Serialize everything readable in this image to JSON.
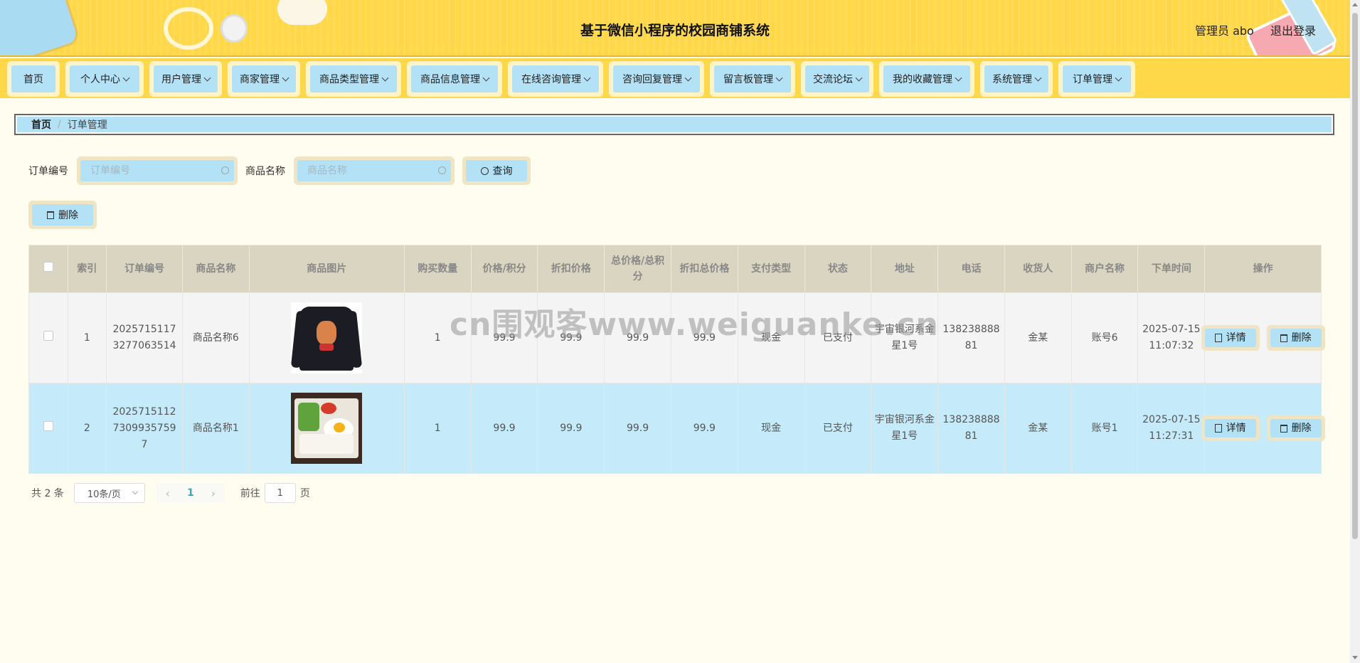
{
  "header": {
    "title": "基于微信小程序的校园商铺系统",
    "admin_label": "管理员 abo",
    "logout_label": "退出登录"
  },
  "nav": {
    "items": [
      {
        "label": "首页",
        "dropdown": false
      },
      {
        "label": "个人中心",
        "dropdown": true
      },
      {
        "label": "用户管理",
        "dropdown": true
      },
      {
        "label": "商家管理",
        "dropdown": true
      },
      {
        "label": "商品类型管理",
        "dropdown": true
      },
      {
        "label": "商品信息管理",
        "dropdown": true
      },
      {
        "label": "在线咨询管理",
        "dropdown": true
      },
      {
        "label": "咨询回复管理",
        "dropdown": true
      },
      {
        "label": "留言板管理",
        "dropdown": true
      },
      {
        "label": "交流论坛",
        "dropdown": true
      },
      {
        "label": "我的收藏管理",
        "dropdown": true
      },
      {
        "label": "系统管理",
        "dropdown": true
      },
      {
        "label": "订单管理",
        "dropdown": true
      }
    ]
  },
  "breadcrumb": {
    "home": "首页",
    "separator": "/",
    "current": "订单管理"
  },
  "search": {
    "order_no_label": "订单编号",
    "order_no_placeholder": "订单编号",
    "order_no_value": "",
    "product_name_label": "商品名称",
    "product_name_placeholder": "商品名称",
    "product_name_value": "",
    "query_label": "查询"
  },
  "toolbar": {
    "delete_label": "删除"
  },
  "table": {
    "headers": {
      "index": "索引",
      "order_no": "订单编号",
      "product_name": "商品名称",
      "product_image": "商品图片",
      "quantity": "购买数量",
      "price_points": "价格/积分",
      "discount_price": "折扣价格",
      "total_price_points": "总价格/总积分",
      "discount_total": "折扣总价格",
      "pay_type": "支付类型",
      "status": "状态",
      "address": "地址",
      "phone": "电话",
      "receiver": "收货人",
      "merchant": "商户名称",
      "order_time": "下单时间",
      "actions": "操作"
    },
    "rows": [
      {
        "index": "1",
        "order_no": "20257151173277063514",
        "product_name": "商品名称6",
        "image": "shirt",
        "quantity": "1",
        "price_points": "99.9",
        "discount_price": "99.9",
        "total_price_points": "99.9",
        "discount_total": "99.9",
        "pay_type": "现金",
        "status": "已支付",
        "address": "宇宙银河系金星1号",
        "phone": "13823888881",
        "receiver": "金某",
        "merchant": "账号6",
        "order_time": "2025-07-15 11:07:32"
      },
      {
        "index": "2",
        "order_no": "202571511273099357597",
        "product_name": "商品名称1",
        "image": "bento",
        "quantity": "1",
        "price_points": "99.9",
        "discount_price": "99.9",
        "total_price_points": "99.9",
        "discount_total": "99.9",
        "pay_type": "现金",
        "status": "已支付",
        "address": "宇宙银河系金星1号",
        "phone": "13823888881",
        "receiver": "金某",
        "merchant": "账号1",
        "order_time": "2025-07-15 11:27:31"
      }
    ],
    "detail_label": "详情",
    "delete_label": "删除"
  },
  "pagination": {
    "total_text": "共 2 条",
    "page_size": "10条/页",
    "current_page": "1",
    "goto_label": "前往",
    "goto_value": "1",
    "page_suffix": "页"
  },
  "watermark": "cn围观客www.weiguanke.cn",
  "colors": {
    "header_bg": "#ffd84a",
    "button_bg": "#b3e1f5",
    "button_border": "#efe4c4",
    "page_bg": "#fffdf0"
  }
}
